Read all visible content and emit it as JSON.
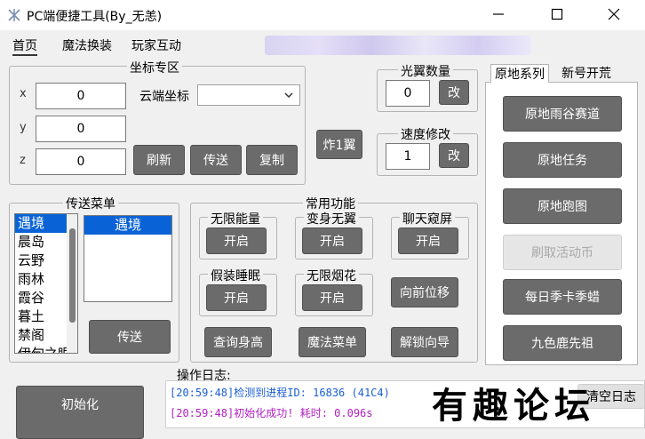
{
  "window": {
    "title": "PC端便捷工具(By_无恙)"
  },
  "menu": {
    "items": [
      "首页",
      "魔法换装",
      "玩家互动"
    ]
  },
  "coord": {
    "title": "坐标专区",
    "x_label": "x",
    "x_value": "0",
    "y_label": "y",
    "y_value": "0",
    "z_label": "z",
    "z_value": "0",
    "cloud_label": "云端坐标",
    "refresh": "刷新",
    "teleport": "传送",
    "copy": "复制"
  },
  "bomb_button": "炸1翼",
  "wings": {
    "title": "光翼数量",
    "value": "0",
    "change": "改"
  },
  "speed": {
    "title": "速度修改",
    "value": "1",
    "change": "改"
  },
  "teleport_menu": {
    "title": "传送菜单",
    "left_items": [
      "遇境",
      "晨岛",
      "云野",
      "雨林",
      "霞谷",
      "暮土",
      "禁阁",
      "伊甸之眼"
    ],
    "right_items": [
      "遇境"
    ],
    "send": "传送"
  },
  "common": {
    "title": "常用功能",
    "infinite_energy": {
      "title": "无限能量",
      "btn": "开启"
    },
    "transform_wing": {
      "title": "变身无翼",
      "btn": "开启"
    },
    "chat_peek": {
      "title": "聊天窥屏",
      "btn": "开启"
    },
    "fake_sleep": {
      "title": "假装睡眠",
      "btn": "开启"
    },
    "infinite_fireworks": {
      "title": "无限烟花",
      "btn": "开启"
    },
    "move_forward": "向前位移",
    "query_height": "查询身高",
    "magic_menu": "魔法菜单",
    "unlock_guide": "解锁向导"
  },
  "right_tabs": {
    "tabs": [
      "原地系列",
      "新号开荒"
    ]
  },
  "right_buttons": [
    "原地雨谷赛道",
    "原地任务",
    "原地跑图",
    "刷取活动币",
    "每日季卡季蜡",
    "九色鹿先祖"
  ],
  "init_button": "初始化",
  "log": {
    "title": "操作日志:",
    "lines": [
      "[20:59:48]检测到进程ID: 16836 (41C4)",
      "[20:59:48]初始化成功! 耗时: 0.096s"
    ],
    "line_colors": [
      "#1a5fd6",
      "#b020c0"
    ],
    "clear": "清空日志"
  },
  "watermark": "有趣论坛"
}
